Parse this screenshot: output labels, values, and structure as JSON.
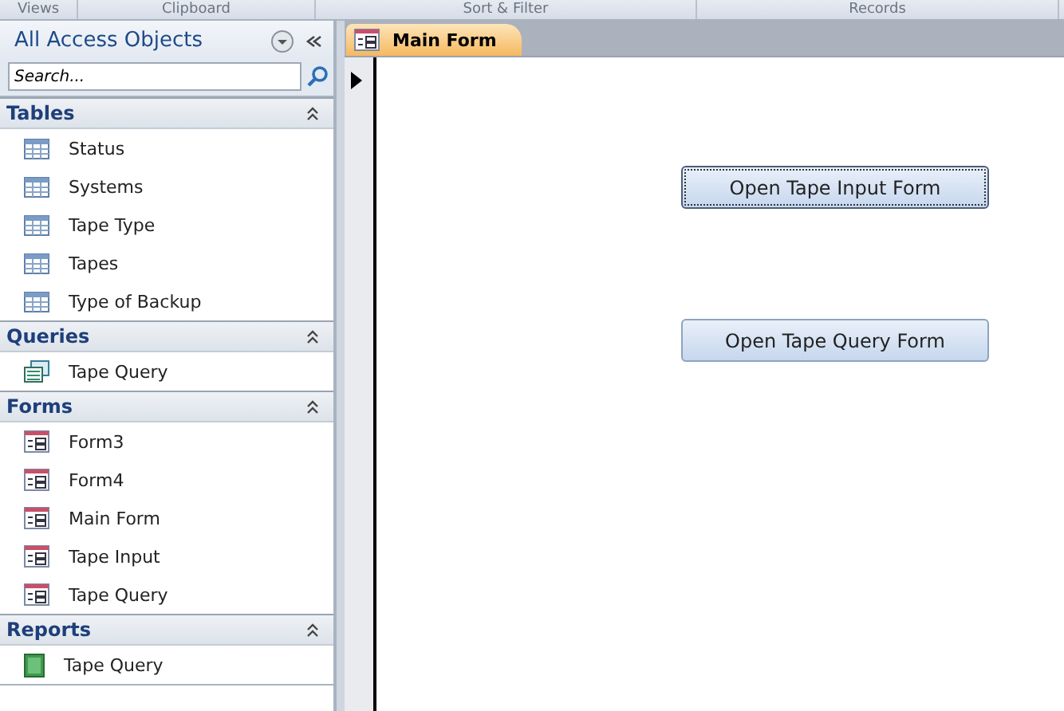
{
  "ribbon_groups": [
    "Views",
    "Clipboard",
    "Sort & Filter",
    "Records"
  ],
  "nav_pane": {
    "title": "All Access Objects",
    "search": {
      "placeholder": "Search..."
    },
    "groups": [
      {
        "title": "Tables",
        "expanded": true,
        "items": [
          {
            "label": "Status",
            "kind": "table"
          },
          {
            "label": "Systems",
            "kind": "table"
          },
          {
            "label": "Tape Type",
            "kind": "table"
          },
          {
            "label": "Tapes",
            "kind": "table"
          },
          {
            "label": "Type of Backup",
            "kind": "table"
          }
        ]
      },
      {
        "title": "Queries",
        "expanded": true,
        "items": [
          {
            "label": "Tape Query",
            "kind": "query"
          }
        ]
      },
      {
        "title": "Forms",
        "expanded": true,
        "items": [
          {
            "label": "Form3",
            "kind": "form"
          },
          {
            "label": "Form4",
            "kind": "form"
          },
          {
            "label": "Main Form",
            "kind": "form"
          },
          {
            "label": "Tape Input",
            "kind": "form"
          },
          {
            "label": "Tape Query",
            "kind": "form"
          }
        ]
      },
      {
        "title": "Reports",
        "expanded": true,
        "items": [
          {
            "label": "Tape Query",
            "kind": "report"
          }
        ]
      }
    ]
  },
  "tabs": [
    {
      "label": "Main Form",
      "selected": true
    }
  ],
  "form": {
    "buttons": [
      {
        "label": "Open Tape Input Form",
        "focused": true
      },
      {
        "label": "Open Tape Query Form",
        "focused": false
      }
    ]
  }
}
